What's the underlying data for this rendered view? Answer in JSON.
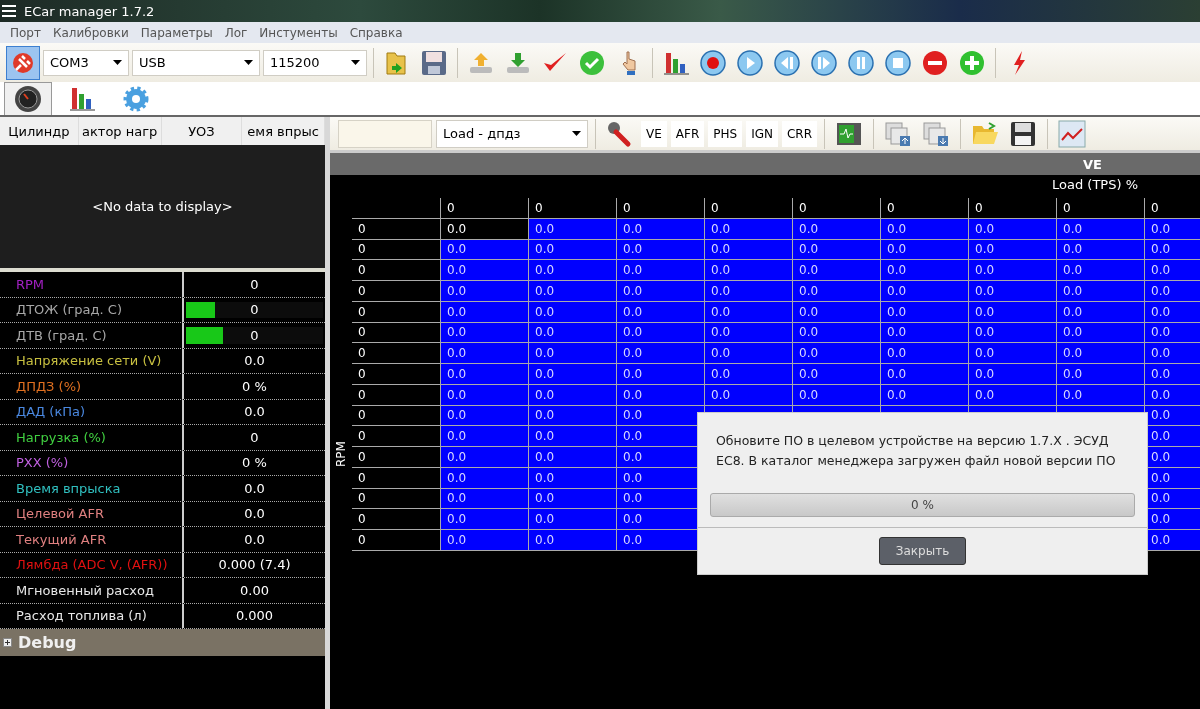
{
  "window": {
    "title": "ECar manager 1.7.2"
  },
  "menu": [
    "Порт",
    "Калибровки",
    "Параметры",
    "Лог",
    "Инстументы",
    "Справка"
  ],
  "toolbar": {
    "connected": true,
    "port": "COM3",
    "interface": "USB",
    "baud": "115200"
  },
  "view_tabs": [
    {
      "kind": "gauge",
      "selected": true
    },
    {
      "kind": "chart",
      "selected": false
    },
    {
      "kind": "settings",
      "selected": false
    }
  ],
  "left_panel": {
    "columns": [
      "Цилиндр",
      "актор нагр",
      "УОЗ",
      "емя впрыс"
    ],
    "empty_text": "<No data to display>"
  },
  "params": [
    {
      "kind": "plain",
      "label": "RPM",
      "color": "#a020c0",
      "value": "0"
    },
    {
      "kind": "bar",
      "label": "ДТОЖ (град. С)",
      "color": "#a8a8a8",
      "value": "0",
      "level": 0.21
    },
    {
      "kind": "bar",
      "label": "ДТВ (град. С)",
      "color": "#a8a8a8",
      "value": "0",
      "level": 0.27
    },
    {
      "kind": "plain",
      "label": "Напряжение сети (V)",
      "color": "#c8c040",
      "value": "0.0"
    },
    {
      "kind": "plain",
      "label": "ДПДЗ (%)",
      "color": "#e07020",
      "value": "0 %"
    },
    {
      "kind": "plain",
      "label": "ДАД (кПа)",
      "color": "#4a88e0",
      "value": "0.0"
    },
    {
      "kind": "plain",
      "label": "Нагрузка (%)",
      "color": "#40d040",
      "value": "0"
    },
    {
      "kind": "plain",
      "label": "РХХ (%)",
      "color": "#c060e0",
      "value": "0 %"
    },
    {
      "kind": "plain",
      "label": "Время впрыска",
      "color": "#30c0c0",
      "value": "0.0"
    },
    {
      "kind": "plain",
      "label": "Целевой AFR",
      "color": "#e08080",
      "value": "0.0"
    },
    {
      "kind": "plain",
      "label": "Текущий AFR",
      "color": "#e08080",
      "value": "0.0"
    },
    {
      "kind": "plain",
      "label": "Лямбда (ADC V, (AFR))",
      "color": "#e01010",
      "value": "0.000 (7.4)"
    },
    {
      "kind": "plain",
      "label": "Мгновенный расход",
      "color": "#e8e8e8",
      "value": "0.00"
    },
    {
      "kind": "plain",
      "label": "Расход топлива (л)",
      "color": "#e8e8e8",
      "value": "0.000"
    }
  ],
  "debug": {
    "label": "Debug",
    "expanded": false
  },
  "map_toolbar": {
    "load_select": "Load - дпдз",
    "tables": [
      "VE",
      "AFR",
      "PHS",
      "IGN",
      "CRR"
    ]
  },
  "map": {
    "title": "VE",
    "x_axis": "Load (TPS) %",
    "y_axis": "RPM",
    "columns": [
      "0",
      "0",
      "0",
      "0",
      "0",
      "0",
      "0",
      "0",
      "0"
    ],
    "rows": [
      {
        "label": "0",
        "cells": [
          {
            "value": "0.0",
            "selected": true
          },
          {
            "value": "0.0",
            "selected": false
          },
          {
            "value": "0.0",
            "selected": false
          },
          {
            "value": "0.0",
            "selected": false
          },
          {
            "value": "0.0",
            "selected": false
          },
          {
            "value": "0.0",
            "selected": false
          },
          {
            "value": "0.0",
            "selected": false
          },
          {
            "value": "0.0",
            "selected": false
          },
          {
            "value": "0.0",
            "selected": false
          }
        ]
      },
      {
        "label": "0",
        "cells": [
          {
            "value": "0.0",
            "selected": false
          },
          {
            "value": "0.0",
            "selected": false
          },
          {
            "value": "0.0",
            "selected": false
          },
          {
            "value": "0.0",
            "selected": false
          },
          {
            "value": "0.0",
            "selected": false
          },
          {
            "value": "0.0",
            "selected": false
          },
          {
            "value": "0.0",
            "selected": false
          },
          {
            "value": "0.0",
            "selected": false
          },
          {
            "value": "0.0",
            "selected": false
          }
        ]
      },
      {
        "label": "0",
        "cells": [
          {
            "value": "0.0",
            "selected": false
          },
          {
            "value": "0.0",
            "selected": false
          },
          {
            "value": "0.0",
            "selected": false
          },
          {
            "value": "0.0",
            "selected": false
          },
          {
            "value": "0.0",
            "selected": false
          },
          {
            "value": "0.0",
            "selected": false
          },
          {
            "value": "0.0",
            "selected": false
          },
          {
            "value": "0.0",
            "selected": false
          },
          {
            "value": "0.0",
            "selected": false
          }
        ]
      },
      {
        "label": "0",
        "cells": [
          {
            "value": "0.0",
            "selected": false
          },
          {
            "value": "0.0",
            "selected": false
          },
          {
            "value": "0.0",
            "selected": false
          },
          {
            "value": "0.0",
            "selected": false
          },
          {
            "value": "0.0",
            "selected": false
          },
          {
            "value": "0.0",
            "selected": false
          },
          {
            "value": "0.0",
            "selected": false
          },
          {
            "value": "0.0",
            "selected": false
          },
          {
            "value": "0.0",
            "selected": false
          }
        ]
      },
      {
        "label": "0",
        "cells": [
          {
            "value": "0.0",
            "selected": false
          },
          {
            "value": "0.0",
            "selected": false
          },
          {
            "value": "0.0",
            "selected": false
          },
          {
            "value": "0.0",
            "selected": false
          },
          {
            "value": "0.0",
            "selected": false
          },
          {
            "value": "0.0",
            "selected": false
          },
          {
            "value": "0.0",
            "selected": false
          },
          {
            "value": "0.0",
            "selected": false
          },
          {
            "value": "0.0",
            "selected": false
          }
        ]
      },
      {
        "label": "0",
        "cells": [
          {
            "value": "0.0",
            "selected": false
          },
          {
            "value": "0.0",
            "selected": false
          },
          {
            "value": "0.0",
            "selected": false
          },
          {
            "value": "0.0",
            "selected": false
          },
          {
            "value": "0.0",
            "selected": false
          },
          {
            "value": "0.0",
            "selected": false
          },
          {
            "value": "0.0",
            "selected": false
          },
          {
            "value": "0.0",
            "selected": false
          },
          {
            "value": "0.0",
            "selected": false
          }
        ]
      },
      {
        "label": "0",
        "cells": [
          {
            "value": "0.0",
            "selected": false
          },
          {
            "value": "0.0",
            "selected": false
          },
          {
            "value": "0.0",
            "selected": false
          },
          {
            "value": "0.0",
            "selected": false
          },
          {
            "value": "0.0",
            "selected": false
          },
          {
            "value": "0.0",
            "selected": false
          },
          {
            "value": "0.0",
            "selected": false
          },
          {
            "value": "0.0",
            "selected": false
          },
          {
            "value": "0.0",
            "selected": false
          }
        ]
      },
      {
        "label": "0",
        "cells": [
          {
            "value": "0.0",
            "selected": false
          },
          {
            "value": "0.0",
            "selected": false
          },
          {
            "value": "0.0",
            "selected": false
          },
          {
            "value": "0.0",
            "selected": false
          },
          {
            "value": "0.0",
            "selected": false
          },
          {
            "value": "0.0",
            "selected": false
          },
          {
            "value": "0.0",
            "selected": false
          },
          {
            "value": "0.0",
            "selected": false
          },
          {
            "value": "0.0",
            "selected": false
          }
        ]
      },
      {
        "label": "0",
        "cells": [
          {
            "value": "0.0",
            "selected": false
          },
          {
            "value": "0.0",
            "selected": false
          },
          {
            "value": "0.0",
            "selected": false
          },
          {
            "value": "0.0",
            "selected": false
          },
          {
            "value": "0.0",
            "selected": false
          },
          {
            "value": "0.0",
            "selected": false
          },
          {
            "value": "0.0",
            "selected": false
          },
          {
            "value": "0.0",
            "selected": false
          },
          {
            "value": "0.0",
            "selected": false
          }
        ]
      },
      {
        "label": "0",
        "cells": [
          {
            "value": "0.0",
            "selected": false
          },
          {
            "value": "0.0",
            "selected": false
          },
          {
            "value": "0.0",
            "selected": false
          },
          null,
          null,
          null,
          null,
          null,
          {
            "value": "0.0",
            "selected": false
          }
        ]
      },
      {
        "label": "0",
        "cells": [
          {
            "value": "0.0",
            "selected": false
          },
          {
            "value": "0.0",
            "selected": false
          },
          {
            "value": "0.0",
            "selected": false
          },
          null,
          null,
          null,
          null,
          null,
          {
            "value": "0.0",
            "selected": false
          }
        ]
      },
      {
        "label": "0",
        "cells": [
          {
            "value": "0.0",
            "selected": false
          },
          {
            "value": "0.0",
            "selected": false
          },
          {
            "value": "0.0",
            "selected": false
          },
          null,
          null,
          null,
          null,
          null,
          {
            "value": "0.0",
            "selected": false
          }
        ]
      },
      {
        "label": "0",
        "cells": [
          {
            "value": "0.0",
            "selected": false
          },
          {
            "value": "0.0",
            "selected": false
          },
          {
            "value": "0.0",
            "selected": false
          },
          null,
          null,
          null,
          null,
          null,
          {
            "value": "0.0",
            "selected": false
          }
        ]
      },
      {
        "label": "0",
        "cells": [
          {
            "value": "0.0",
            "selected": false
          },
          {
            "value": "0.0",
            "selected": false
          },
          {
            "value": "0.0",
            "selected": false
          },
          null,
          null,
          null,
          null,
          null,
          {
            "value": "0.0",
            "selected": false
          }
        ]
      },
      {
        "label": "0",
        "cells": [
          {
            "value": "0.0",
            "selected": false
          },
          {
            "value": "0.0",
            "selected": false
          },
          {
            "value": "0.0",
            "selected": false
          },
          null,
          null,
          null,
          null,
          null,
          {
            "value": "0.0",
            "selected": false
          }
        ]
      },
      {
        "label": "0",
        "cells": [
          {
            "value": "0.0",
            "selected": false
          },
          {
            "value": "0.0",
            "selected": false
          },
          {
            "value": "0.0",
            "selected": false
          },
          null,
          null,
          null,
          null,
          null,
          {
            "value": "0.0",
            "selected": false
          }
        ]
      }
    ]
  },
  "dialog": {
    "message": "Обновите ПО в целевом устройстве на версию 1.7.X . ЭСУД EC8. В каталог менеджера загружен файл новой версии ПО",
    "progress": {
      "level": 0,
      "reading": "0 %"
    },
    "button": "Закрыть"
  }
}
